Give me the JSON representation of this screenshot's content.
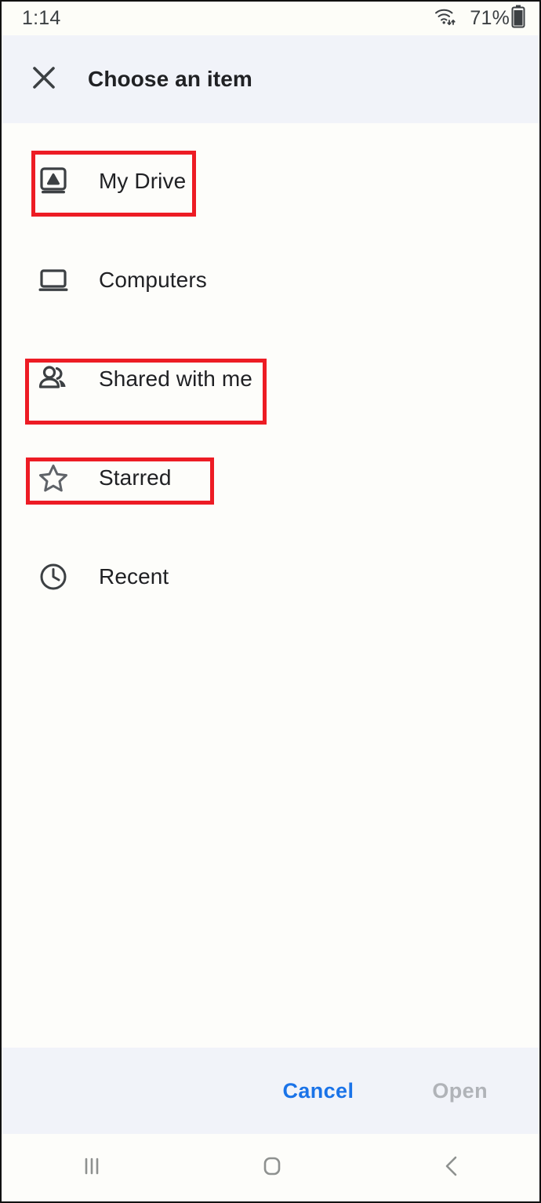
{
  "status_bar": {
    "time": "1:14",
    "battery_percent": "71%",
    "wifi_icon": "wifi-icon",
    "battery_icon": "battery-icon"
  },
  "header": {
    "title": "Choose an item",
    "close_icon": "close-icon"
  },
  "list": {
    "items": [
      {
        "label": "My Drive",
        "icon": "drive-icon",
        "highlighted": true
      },
      {
        "label": "Computers",
        "icon": "laptop-icon",
        "highlighted": false
      },
      {
        "label": "Shared with me",
        "icon": "people-icon",
        "highlighted": true
      },
      {
        "label": "Starred",
        "icon": "star-icon",
        "highlighted": true
      },
      {
        "label": "Recent",
        "icon": "clock-icon",
        "highlighted": false
      }
    ]
  },
  "footer": {
    "cancel_label": "Cancel",
    "open_label": "Open"
  },
  "nav_bar": {
    "recents_icon": "recents-icon",
    "home_icon": "home-icon",
    "back_icon": "back-icon"
  },
  "colors": {
    "annotation": "#ed1c24",
    "accent": "#1a73e8",
    "disabled": "#b0b3b8",
    "header_bg": "#f1f3f9",
    "text": "#202124"
  }
}
